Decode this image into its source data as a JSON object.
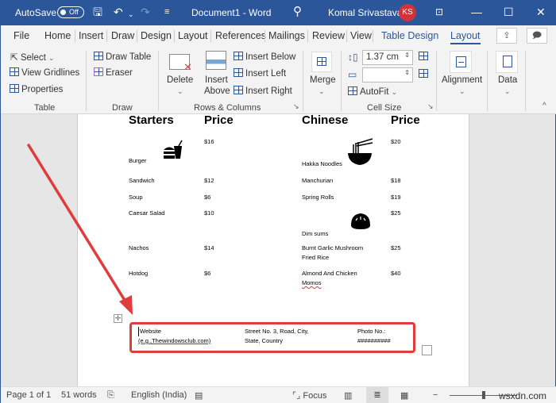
{
  "titlebar": {
    "autosave_label": "AutoSave",
    "autosave_state": "Off",
    "doc_title": "Document1 - Word",
    "user_name": "Komal Srivastava",
    "user_initials": "KS",
    "icons": [
      "save-icon",
      "undo-icon",
      "redo-icon",
      "customize-qat-icon",
      "search-icon",
      "ribbon-display-icon",
      "minimize-icon",
      "maximize-icon",
      "close-icon"
    ],
    "undo_glyph": "↶",
    "redo_glyph": "↷",
    "save_glyph": "🖫",
    "search_glyph": "⚲",
    "minimize_glyph": "—",
    "maximize_glyph": "☐",
    "close_glyph": "✕",
    "qat_glyph": "≡"
  },
  "tabs": [
    "File",
    "Home",
    "Insert",
    "Draw",
    "Design",
    "Layout",
    "References",
    "Mailings",
    "Review",
    "View",
    "Table Design",
    "Layout"
  ],
  "active_tab": "Layout",
  "share_glyph": "⇪",
  "comments_glyph": "🗩",
  "ribbon": {
    "table_group": {
      "label": "Table",
      "select": "Select",
      "view_gridlines": "View Gridlines",
      "properties": "Properties"
    },
    "draw_group": {
      "label": "Draw",
      "draw_table": "Draw Table",
      "eraser": "Eraser"
    },
    "rows_columns_group": {
      "label": "Rows & Columns",
      "delete": "Delete",
      "insert_above_1": "Insert",
      "insert_above_2": "Above",
      "insert_below": "Insert Below",
      "insert_left": "Insert Left",
      "insert_right": "Insert Right"
    },
    "merge_group": {
      "label": "Merge"
    },
    "cell_size_group": {
      "label": "Cell Size",
      "height_value": "1.37 cm",
      "width_value": "",
      "autofit": "AutoFit"
    },
    "alignment_group": {
      "label": "Alignment"
    },
    "data_group": {
      "label": "Data"
    },
    "chevron": "⌄",
    "collapse_glyph": "^",
    "launcher_glyph": "↘"
  },
  "document": {
    "starters_header": "Starters",
    "starters_price_header": "Price",
    "chinese_header": "Chinese",
    "chinese_price_header": "Price",
    "starters": [
      {
        "name": "Burger",
        "price": "$16"
      },
      {
        "name": "Sandwich",
        "price": "$12"
      },
      {
        "name": "Soup",
        "price": "$6"
      },
      {
        "name": "Caesar Salad",
        "price": "$10"
      },
      {
        "name": "Nachos",
        "price": "$14"
      },
      {
        "name": "Hotdog",
        "price": "$6"
      }
    ],
    "chinese": [
      {
        "name": "Hakka Noodles",
        "price": "$20"
      },
      {
        "name": "Manchurian",
        "price": "$18"
      },
      {
        "name": "Spring Rolls",
        "price": "$19"
      },
      {
        "name": "Dim sums",
        "price": "$25"
      },
      {
        "name_line1": "Burnt Garlic Mushroom",
        "name_line2": "Fried Rice",
        "price": "$25"
      },
      {
        "name_line1": "Almond And Chicken",
        "name_line2": "Momos",
        "price": "$40"
      }
    ],
    "footer": {
      "website_line1": "Website",
      "website_line2": "(e.g.,Thewindowsclub.com)",
      "address_line1": "Street No. 3, Road, City,",
      "address_line2": "State, Country",
      "photo_line1": "Photo No.:",
      "photo_line2": "##########"
    },
    "move_handle_glyph": "✛"
  },
  "statusbar": {
    "page": "Page 1 of 1",
    "words": "51 words",
    "language": "English (India)",
    "focus": "Focus",
    "zoom_minus": "−",
    "watermark": "wsxdn.com",
    "zoom_level_fraction": 0.5
  },
  "annotation_color": "#e03c3c",
  "accent_color": "#2b579a"
}
